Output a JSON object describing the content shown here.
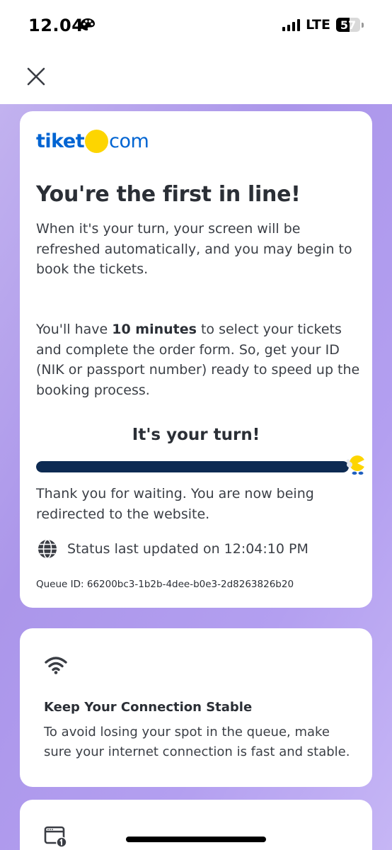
{
  "status_bar": {
    "time": "12.04",
    "network": "LTE",
    "battery": "57",
    "battery_level": 0.57,
    "app_icon": "palette-icon"
  },
  "nav": {
    "close_icon": "close-icon"
  },
  "brand": {
    "logo_left": "tiket",
    "logo_right": "com",
    "logo_blue": "#0064d2",
    "logo_yellow": "#fdd500"
  },
  "queue": {
    "headline": "You're the first in line!",
    "intro": "When it's your turn, your screen will be refreshed automatically, and you may begin to book the tickets.",
    "time_prefix": "You'll have ",
    "time_bold": "10 minutes",
    "time_suffix": " to select your tickets and complete the order form. So, get your ID (NIK or passport number) ready to speed up the booking process.",
    "turn_title": "It's your turn!",
    "progress": 1.0,
    "progress_color": "#0d2a52",
    "redirect_message": "Thank you for waiting. You are now being redirected to the website.",
    "status_icon": "globe-icon",
    "status_updated": "Status last updated on 12:04:10 PM",
    "queue_id": "Queue ID: 66200bc3-1b2b-4dee-b0e3-2d8263826b20"
  },
  "tips": [
    {
      "icon": "wifi-icon",
      "title": "Keep Your Connection Stable",
      "body": "To avoid losing your spot in the queue, make sure your internet connection is fast and stable."
    },
    {
      "icon": "browser-window-icon"
    }
  ],
  "colors": {
    "purple_bg": "#ab96ea",
    "card_bg": "#ffffff",
    "text_dark": "#2b2f36"
  }
}
